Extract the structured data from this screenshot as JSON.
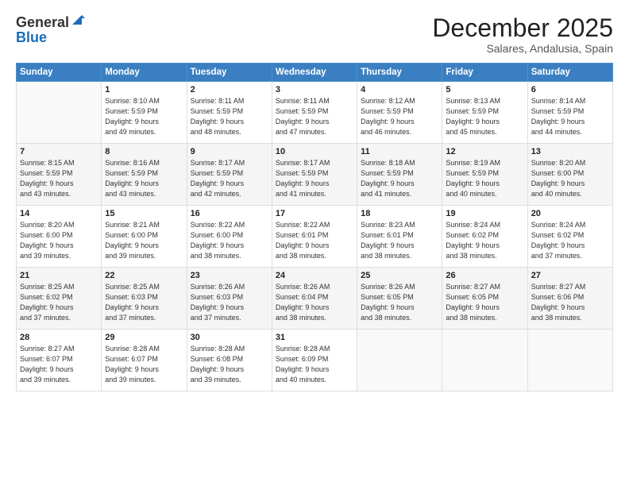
{
  "header": {
    "logo_general": "General",
    "logo_blue": "Blue",
    "month": "December 2025",
    "location": "Salares, Andalusia, Spain"
  },
  "days_of_week": [
    "Sunday",
    "Monday",
    "Tuesday",
    "Wednesday",
    "Thursday",
    "Friday",
    "Saturday"
  ],
  "weeks": [
    [
      {
        "num": "",
        "info": ""
      },
      {
        "num": "1",
        "info": "Sunrise: 8:10 AM\nSunset: 5:59 PM\nDaylight: 9 hours\nand 49 minutes."
      },
      {
        "num": "2",
        "info": "Sunrise: 8:11 AM\nSunset: 5:59 PM\nDaylight: 9 hours\nand 48 minutes."
      },
      {
        "num": "3",
        "info": "Sunrise: 8:11 AM\nSunset: 5:59 PM\nDaylight: 9 hours\nand 47 minutes."
      },
      {
        "num": "4",
        "info": "Sunrise: 8:12 AM\nSunset: 5:59 PM\nDaylight: 9 hours\nand 46 minutes."
      },
      {
        "num": "5",
        "info": "Sunrise: 8:13 AM\nSunset: 5:59 PM\nDaylight: 9 hours\nand 45 minutes."
      },
      {
        "num": "6",
        "info": "Sunrise: 8:14 AM\nSunset: 5:59 PM\nDaylight: 9 hours\nand 44 minutes."
      }
    ],
    [
      {
        "num": "7",
        "info": "Sunrise: 8:15 AM\nSunset: 5:59 PM\nDaylight: 9 hours\nand 43 minutes."
      },
      {
        "num": "8",
        "info": "Sunrise: 8:16 AM\nSunset: 5:59 PM\nDaylight: 9 hours\nand 43 minutes."
      },
      {
        "num": "9",
        "info": "Sunrise: 8:17 AM\nSunset: 5:59 PM\nDaylight: 9 hours\nand 42 minutes."
      },
      {
        "num": "10",
        "info": "Sunrise: 8:17 AM\nSunset: 5:59 PM\nDaylight: 9 hours\nand 41 minutes."
      },
      {
        "num": "11",
        "info": "Sunrise: 8:18 AM\nSunset: 5:59 PM\nDaylight: 9 hours\nand 41 minutes."
      },
      {
        "num": "12",
        "info": "Sunrise: 8:19 AM\nSunset: 5:59 PM\nDaylight: 9 hours\nand 40 minutes."
      },
      {
        "num": "13",
        "info": "Sunrise: 8:20 AM\nSunset: 6:00 PM\nDaylight: 9 hours\nand 40 minutes."
      }
    ],
    [
      {
        "num": "14",
        "info": "Sunrise: 8:20 AM\nSunset: 6:00 PM\nDaylight: 9 hours\nand 39 minutes."
      },
      {
        "num": "15",
        "info": "Sunrise: 8:21 AM\nSunset: 6:00 PM\nDaylight: 9 hours\nand 39 minutes."
      },
      {
        "num": "16",
        "info": "Sunrise: 8:22 AM\nSunset: 6:00 PM\nDaylight: 9 hours\nand 38 minutes."
      },
      {
        "num": "17",
        "info": "Sunrise: 8:22 AM\nSunset: 6:01 PM\nDaylight: 9 hours\nand 38 minutes."
      },
      {
        "num": "18",
        "info": "Sunrise: 8:23 AM\nSunset: 6:01 PM\nDaylight: 9 hours\nand 38 minutes."
      },
      {
        "num": "19",
        "info": "Sunrise: 8:24 AM\nSunset: 6:02 PM\nDaylight: 9 hours\nand 38 minutes."
      },
      {
        "num": "20",
        "info": "Sunrise: 8:24 AM\nSunset: 6:02 PM\nDaylight: 9 hours\nand 37 minutes."
      }
    ],
    [
      {
        "num": "21",
        "info": "Sunrise: 8:25 AM\nSunset: 6:02 PM\nDaylight: 9 hours\nand 37 minutes."
      },
      {
        "num": "22",
        "info": "Sunrise: 8:25 AM\nSunset: 6:03 PM\nDaylight: 9 hours\nand 37 minutes."
      },
      {
        "num": "23",
        "info": "Sunrise: 8:26 AM\nSunset: 6:03 PM\nDaylight: 9 hours\nand 37 minutes."
      },
      {
        "num": "24",
        "info": "Sunrise: 8:26 AM\nSunset: 6:04 PM\nDaylight: 9 hours\nand 38 minutes."
      },
      {
        "num": "25",
        "info": "Sunrise: 8:26 AM\nSunset: 6:05 PM\nDaylight: 9 hours\nand 38 minutes."
      },
      {
        "num": "26",
        "info": "Sunrise: 8:27 AM\nSunset: 6:05 PM\nDaylight: 9 hours\nand 38 minutes."
      },
      {
        "num": "27",
        "info": "Sunrise: 8:27 AM\nSunset: 6:06 PM\nDaylight: 9 hours\nand 38 minutes."
      }
    ],
    [
      {
        "num": "28",
        "info": "Sunrise: 8:27 AM\nSunset: 6:07 PM\nDaylight: 9 hours\nand 39 minutes."
      },
      {
        "num": "29",
        "info": "Sunrise: 8:28 AM\nSunset: 6:07 PM\nDaylight: 9 hours\nand 39 minutes."
      },
      {
        "num": "30",
        "info": "Sunrise: 8:28 AM\nSunset: 6:08 PM\nDaylight: 9 hours\nand 39 minutes."
      },
      {
        "num": "31",
        "info": "Sunrise: 8:28 AM\nSunset: 6:09 PM\nDaylight: 9 hours\nand 40 minutes."
      },
      {
        "num": "",
        "info": ""
      },
      {
        "num": "",
        "info": ""
      },
      {
        "num": "",
        "info": ""
      }
    ]
  ]
}
